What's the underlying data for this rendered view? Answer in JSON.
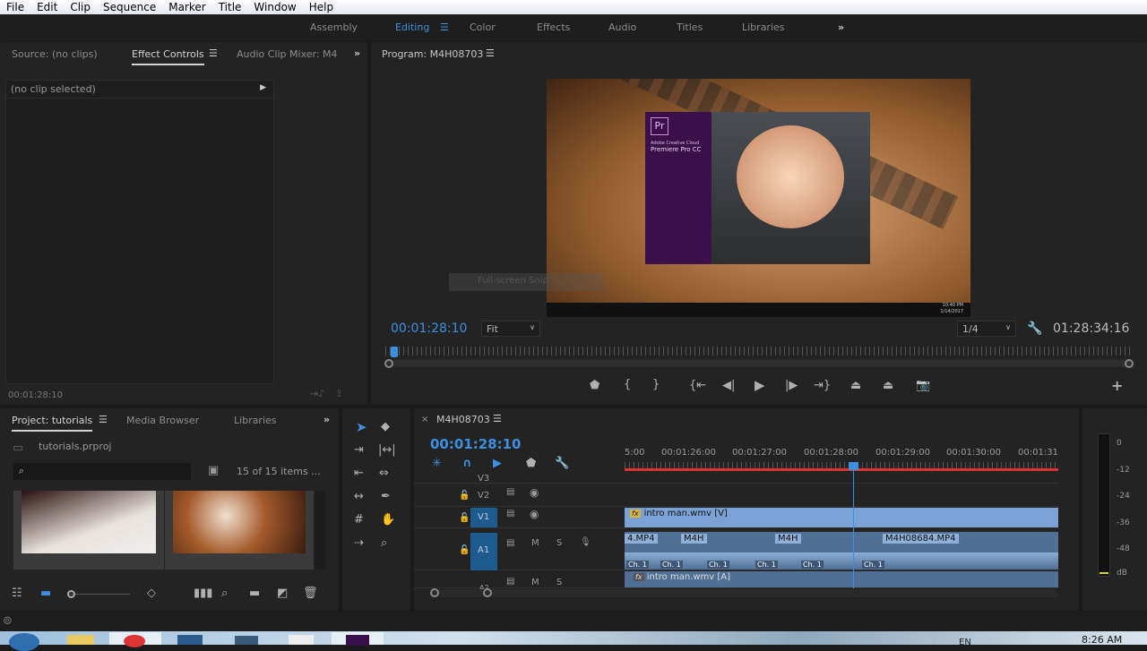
{
  "menu": [
    "File",
    "Edit",
    "Clip",
    "Sequence",
    "Marker",
    "Title",
    "Window",
    "Help"
  ],
  "workspaces": [
    "Assembly",
    "Editing",
    "Color",
    "Effects",
    "Audio",
    "Titles",
    "Libraries"
  ],
  "workspace_more": "»",
  "source_panel": {
    "tabs": [
      "Source: (no clips)",
      "Effect Controls",
      "Audio Clip Mixer: M4"
    ],
    "more": "»",
    "no_clip": "(no clip selected)",
    "timecode": "00:01:28:10"
  },
  "program": {
    "title": "Program: M4H08703",
    "timecode": "00:01:28:10",
    "fit": "Fit",
    "resolution": "1/4",
    "duration": "01:28:34:16",
    "preview": {
      "logo": "Pr",
      "line1": "Adobe Creative Cloud",
      "line2": "Premiere Pro CC",
      "snip": "Full-screen Snip",
      "clock": "10:40 PM",
      "date": "1/14/2017"
    }
  },
  "project": {
    "tabs": [
      "Project: tutorials",
      "Media Browser",
      "Libraries"
    ],
    "more": "»",
    "file": "tutorials.prproj",
    "search_placeholder": "",
    "count": "15 of 15 items ..."
  },
  "timeline": {
    "title": "M4H08703",
    "close": "×",
    "timecode": "00:01:28:10",
    "ruler": [
      "5:00",
      "00:01:26:00",
      "00:01:27:00",
      "00:01:28:00",
      "00:01:29:00",
      "00:01:30:00",
      "00:01:31"
    ],
    "tracks": {
      "v3": "V3",
      "v2": "V2",
      "v1": "V1",
      "a1": "A1",
      "a2": "A2",
      "m": "M",
      "s": "S"
    },
    "clips": {
      "v1": "intro man.wmv [V]",
      "a2": "intro man.wmv [A]",
      "a1": [
        "4.MP4",
        "M4H",
        "M4H",
        "M4H08684.MP4"
      ],
      "ch": "Ch. 1",
      "fx": "fx"
    }
  },
  "meters": {
    "labels": [
      "0",
      "-12",
      "-24",
      "-36",
      "-48",
      "dB"
    ]
  },
  "taskbar": {
    "lang": "EN",
    "time": "8:26 AM"
  },
  "colors": {
    "accent": "#3d8fe0",
    "clip_video": "#7ba2d4",
    "clip_audio": "#4f6f94",
    "playhead_bar": "#e03030"
  }
}
